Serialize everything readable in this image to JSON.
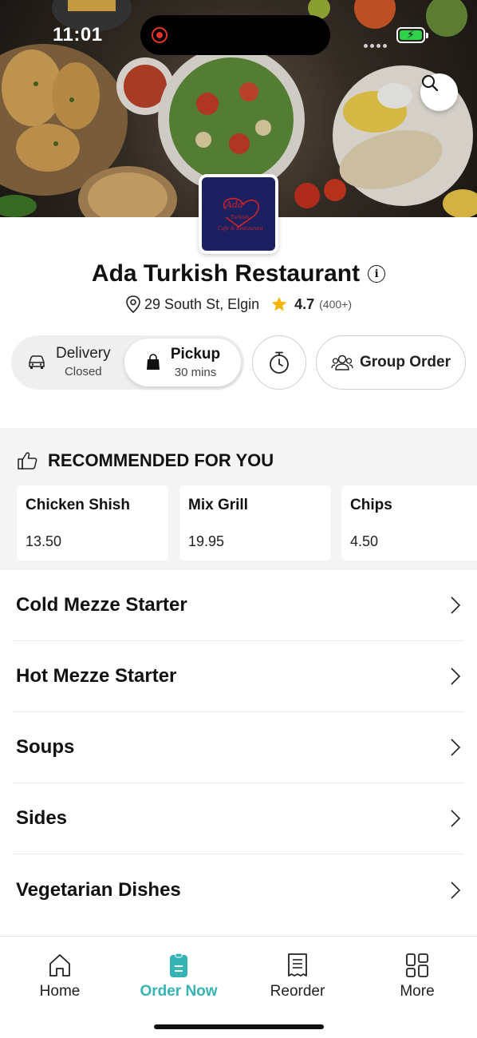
{
  "status_bar": {
    "time": "11:01"
  },
  "restaurant": {
    "name": "Ada Turkish Restaurant",
    "address": "29 South St, Elgin",
    "rating": "4.7",
    "rating_count": "(400+)",
    "logo_text_1": "Ada",
    "logo_text_2": "Turkish",
    "logo_text_3": "Cafe & Restaurant"
  },
  "order_modes": {
    "delivery": {
      "label": "Delivery",
      "status": "Closed"
    },
    "pickup": {
      "label": "Pickup",
      "time": "30 mins"
    },
    "group_order_label": "Group Order"
  },
  "recommended": {
    "heading": "RECOMMENDED FOR YOU",
    "items": [
      {
        "name": "Chicken Shish",
        "price": "13.50"
      },
      {
        "name": "Mix Grill",
        "price": "19.95"
      },
      {
        "name": "Chips",
        "price": "4.50"
      }
    ]
  },
  "categories": [
    {
      "label": "Cold Mezze Starter"
    },
    {
      "label": "Hot Mezze Starter"
    },
    {
      "label": "Soups"
    },
    {
      "label": "Sides"
    },
    {
      "label": "Vegetarian Dishes"
    }
  ],
  "bottom_nav": [
    {
      "label": "Home",
      "icon": "home-icon",
      "active": false
    },
    {
      "label": "Order Now",
      "icon": "order-icon",
      "active": true
    },
    {
      "label": "Reorder",
      "icon": "receipt-icon",
      "active": false
    },
    {
      "label": "More",
      "icon": "grid-icon",
      "active": false
    }
  ],
  "colors": {
    "accent": "#35b3b5",
    "star": "#f5b400",
    "logo_bg": "#1b2160",
    "logo_text": "#d2232a"
  }
}
